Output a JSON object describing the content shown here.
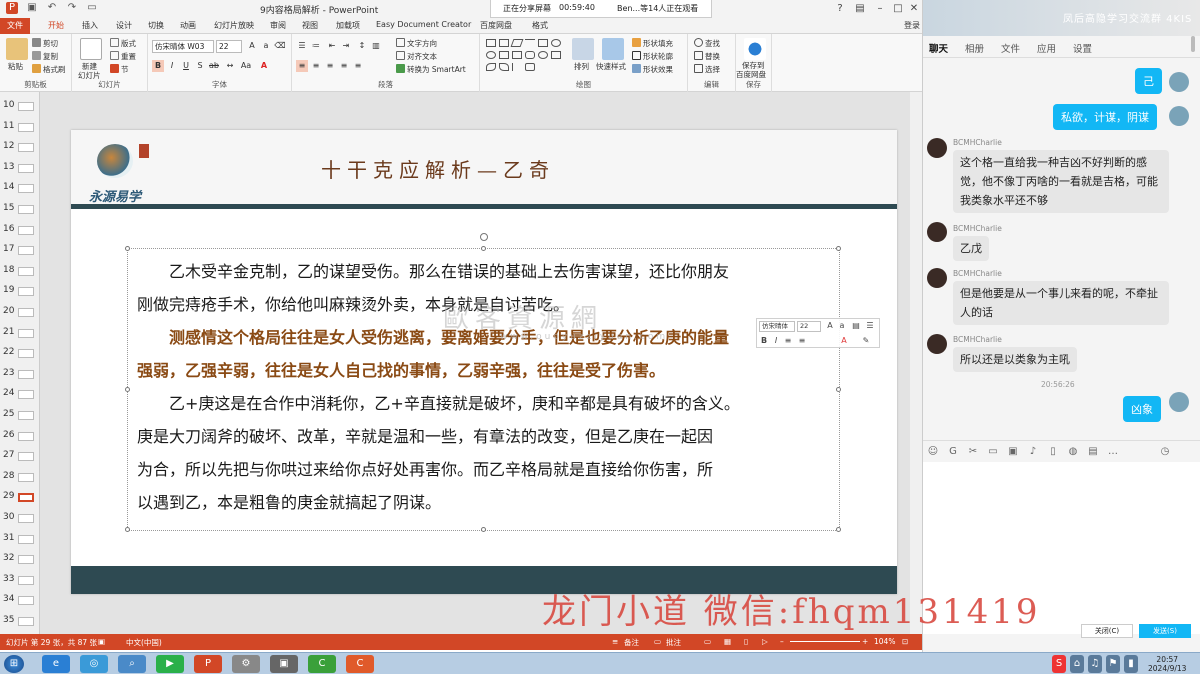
{
  "window": {
    "title": "9内容格局解析 - PowerPoint",
    "sharing_label": "正在分享屏幕",
    "timer": "00:59:40",
    "viewers": "Ben...等14人正在观看",
    "login": "登录"
  },
  "tabs": [
    "文件",
    "开始",
    "插入",
    "设计",
    "切换",
    "动画",
    "幻灯片放映",
    "审阅",
    "视图",
    "加载项",
    "Easy Document Creator",
    "百度网盘",
    "格式"
  ],
  "ribbon": {
    "clipboard": {
      "label": "剪贴板",
      "paste": "粘贴",
      "cut": "剪切",
      "copy": "复制",
      "painter": "格式刷"
    },
    "slides": {
      "label": "幻灯片",
      "new": "新建",
      "new2": "幻灯片",
      "layout": "版式",
      "reset": "重置",
      "section": "节"
    },
    "font": {
      "label": "字体",
      "name": "仿宋晴体 W03",
      "size": "22"
    },
    "paragraph": {
      "label": "段落",
      "direction": "文字方向",
      "align": "对齐文本",
      "smartart": "转换为 SmartArt"
    },
    "drawing": {
      "label": "绘图",
      "arrange": "排列",
      "quick": "快速样式",
      "fill": "形状填充",
      "outline": "形状轮廓",
      "effect": "形状效果"
    },
    "editing": {
      "label": "编辑",
      "find": "查找",
      "replace": "替换",
      "select": "选择"
    },
    "save": {
      "label": "保存",
      "btn": "保存到",
      "btn2": "百度网盘"
    }
  },
  "thumbnails": [
    "10",
    "11",
    "12",
    "13",
    "14",
    "15",
    "16",
    "17",
    "18",
    "19",
    "20",
    "21",
    "22",
    "23",
    "24",
    "25",
    "26",
    "27",
    "28",
    "29",
    "30",
    "31",
    "32",
    "33",
    "34",
    "35"
  ],
  "selected_thumb": "29",
  "slide": {
    "logo_text": "永源易学",
    "title": "十干克应解析—乙奇",
    "para1_line1": "乙木受辛金克制，乙的谋望受伤。那么在错误的基础上去伤害谋望，还比你朋友",
    "para1_line2": "刚做完痔疮手术，你给他叫麻辣烫外卖，本身就是自讨苦吃。",
    "para2_line1": "测感情这个格局往往是女人受伤逃离，要离婚要分手，但是也要分析乙庚的能量",
    "para2_line2": "强弱，乙强辛弱，往往是女人自己找的事情，乙弱辛强，往往是受了伤害。",
    "para3_line1": "乙+庚这是在合作中消耗你，乙+辛直接就是破坏，庚和辛都是具有破坏的含义。",
    "para3_line2": "庚是大刀阔斧的破坏、改革，辛就是温和一些，有章法的改变，但是乙庚在一起因",
    "para3_line3": "为合，所以先把与你哄过来给你点好处再害你。而乙辛格局就是直接给你伤害，所",
    "para3_line4": "以遇到乙，本是粗鲁的庚金就搞起了阴谋。"
  },
  "mini_toolbar": {
    "font": "仿宋晴体",
    "size": "22"
  },
  "watermark": {
    "main": "歐客資源網",
    "sub": "www.ouoyuzziyuan.com"
  },
  "status": {
    "slide_info": "幻灯片 第 29 张，共 87 张",
    "lang": "中文(中国)",
    "notes": "备注",
    "comments": "批注",
    "zoom": "104%"
  },
  "chat": {
    "group_name": "凤后高隐学习交流群 4KIS",
    "tabs": [
      "聊天",
      "相册",
      "文件",
      "应用",
      "设置"
    ],
    "messages": [
      {
        "side": "right",
        "text": "己"
      },
      {
        "side": "right",
        "text": "私欲，计谋，阴谋"
      },
      {
        "side": "left",
        "name": "BCMHCharlie",
        "text": "这个格一直给我一种吉凶不好判断的感觉，他不像丁丙啥的一看就是吉格，可能我类象水平还不够"
      },
      {
        "side": "left",
        "name": "BCMHCharlie",
        "text": "乙戊"
      },
      {
        "side": "left",
        "name": "BCMHCharlie",
        "text": "但是他要是从一个事儿来看的呢，不牵扯人的话"
      },
      {
        "side": "left",
        "name": "BCMHCharlie",
        "text": "所以还是以类象为主吼"
      },
      {
        "side": "time",
        "text": "20:56:26"
      },
      {
        "side": "right",
        "text": "凶象"
      }
    ],
    "close": "关闭(C)",
    "send": "发送(S)"
  },
  "promo": "龙门小道 微信:fhqm131419",
  "clock": {
    "time": "20:57",
    "date": "2024/9/13"
  }
}
